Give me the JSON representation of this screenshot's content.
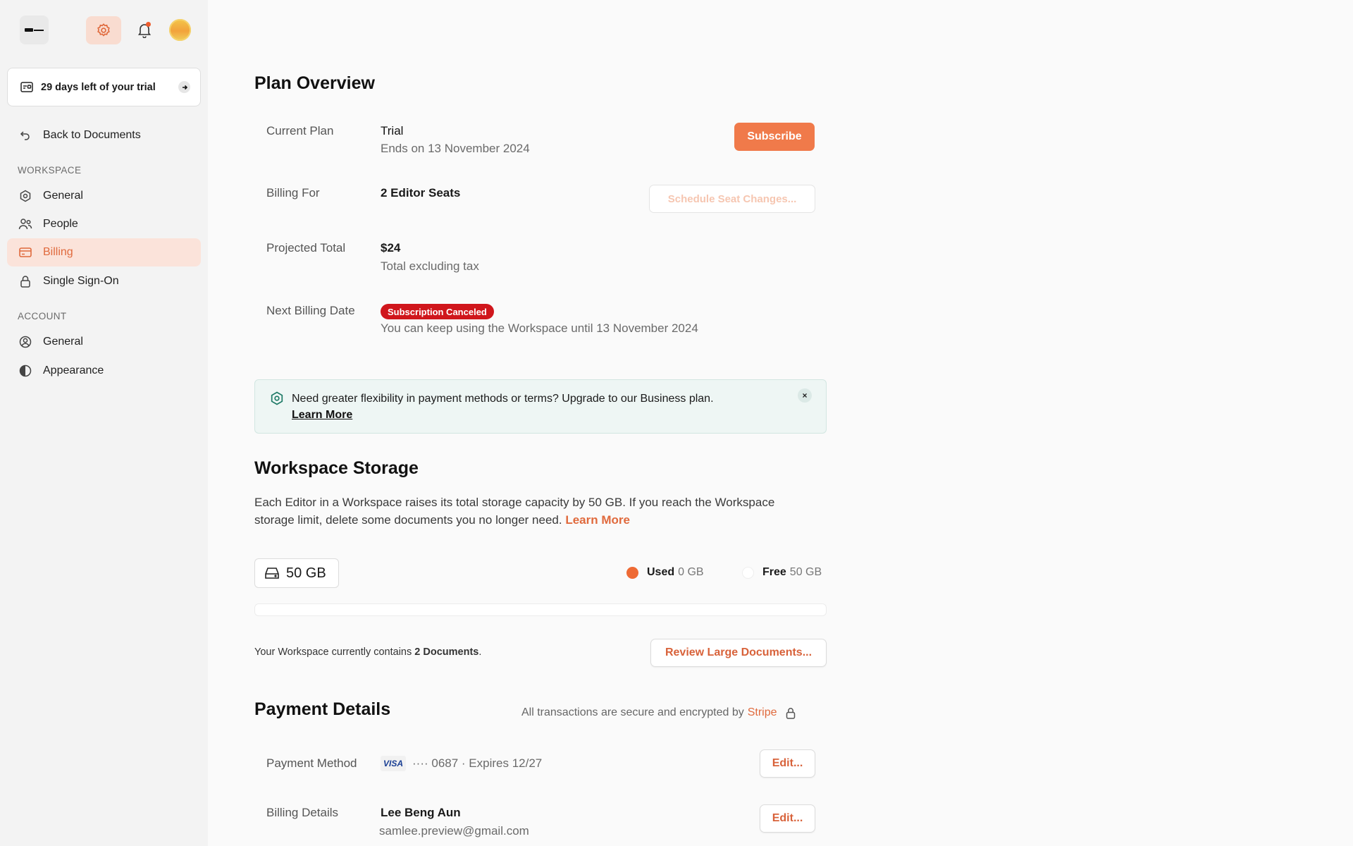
{
  "sidebar": {
    "trial_text": "29 days left of your trial",
    "back_label": "Back to Documents",
    "workspace_label": "WORKSPACE",
    "workspace_items": [
      "General",
      "People",
      "Billing",
      "Single Sign-On"
    ],
    "account_label": "ACCOUNT",
    "account_items": [
      "General",
      "Appearance"
    ],
    "active_item": "Billing"
  },
  "colors": {
    "accent": "#f07a4a",
    "danger": "#d0161c",
    "active_bg": "#fbe3da"
  },
  "plan": {
    "title": "Plan Overview",
    "current_plan_label": "Current Plan",
    "current_plan_value": "Trial",
    "current_plan_sub": "Ends on 13 November 2024",
    "subscribe_label": "Subscribe",
    "billing_for_label": "Billing For",
    "billing_for_value": "2 Editor Seats",
    "schedule_label": "Schedule Seat Changes...",
    "projected_label": "Projected Total",
    "projected_value": "$24",
    "projected_sub": "Total excluding tax",
    "next_billing_label": "Next Billing Date",
    "badge": "Subscription Canceled",
    "next_billing_sub": "You can keep using the Workspace until 13 November 2024"
  },
  "banner": {
    "text": "Need greater flexibility in payment methods or terms? Upgrade to our Business plan.",
    "link": "Learn More",
    "close": "×"
  },
  "storage": {
    "title": "Workspace Storage",
    "para_text": "Each Editor in a Workspace raises its total storage capacity by 50 GB. If you reach the Workspace storage limit, delete some documents you no longer need.",
    "para_link": "Learn More",
    "capacity": "50 GB",
    "used_label": "Used",
    "used_value": "0 GB",
    "free_label": "Free",
    "free_value": "50 GB",
    "docs_prefix": "Your Workspace currently contains",
    "docs_count": "2 Documents",
    "docs_suffix": ".",
    "review_label": "Review Large Documents..."
  },
  "payment": {
    "title": "Payment Details",
    "secure_text": "All transactions are secure and encrypted by",
    "secure_brand": "Stripe",
    "method_label": "Payment Method",
    "card_brand": "VISA",
    "card_text": "···· 0687 · Expires 12/27",
    "edit_label": "Edit...",
    "details_label": "Billing Details",
    "details_name": "Lee Beng Aun",
    "details_email": "samlee.preview@gmail.com"
  }
}
